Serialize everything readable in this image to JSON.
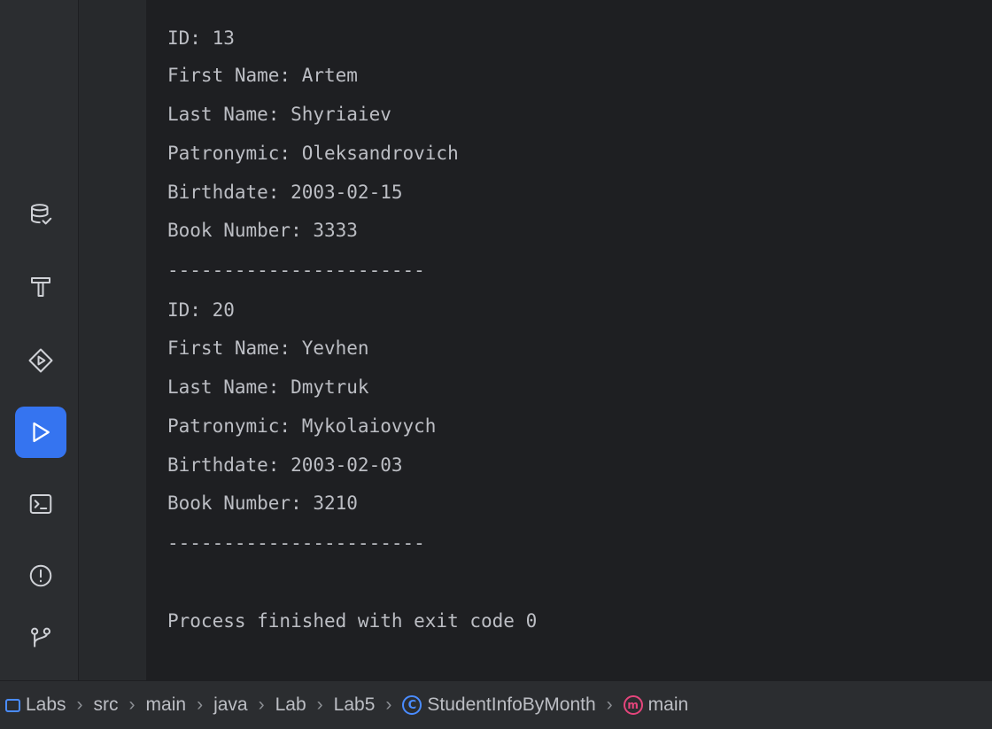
{
  "console": {
    "lines": [
      "ID: 13",
      "First Name: Artem",
      "Last Name: Shyriaiev",
      "Patronymic: Oleksandrovich",
      "Birthdate: 2003-02-15",
      "Book Number: 3333",
      "-----------------------",
      "ID: 20",
      "First Name: Yevhen",
      "Last Name: Dmytruk",
      "Patronymic: Mykolaiovych",
      "Birthdate: 2003-02-03",
      "Book Number: 3210",
      "-----------------------",
      "",
      "Process finished with exit code 0"
    ]
  },
  "toolstrip": {
    "tools": [
      {
        "icon": "database-icon",
        "active": false
      },
      {
        "icon": "hammer-icon",
        "active": false
      },
      {
        "icon": "services-icon",
        "active": false
      },
      {
        "icon": "run-icon",
        "active": true
      },
      {
        "icon": "terminal-icon",
        "active": false
      },
      {
        "icon": "problems-icon",
        "active": false
      },
      {
        "icon": "git-icon",
        "active": false
      }
    ]
  },
  "breadcrumb": {
    "items": [
      {
        "label": "Labs",
        "icon": "folder-icon"
      },
      {
        "label": "src"
      },
      {
        "label": "main"
      },
      {
        "label": "java"
      },
      {
        "label": "Lab"
      },
      {
        "label": "Lab5"
      },
      {
        "label": "StudentInfoByMonth",
        "icon": "class-icon",
        "icon_glyph": "C"
      },
      {
        "label": "main",
        "icon": "method-icon",
        "icon_glyph": "m"
      }
    ],
    "separator": "›"
  },
  "colors": {
    "background": "#1e1f22",
    "panel": "#2b2d30",
    "text": "#bcbec4",
    "accent": "#3574f0"
  }
}
